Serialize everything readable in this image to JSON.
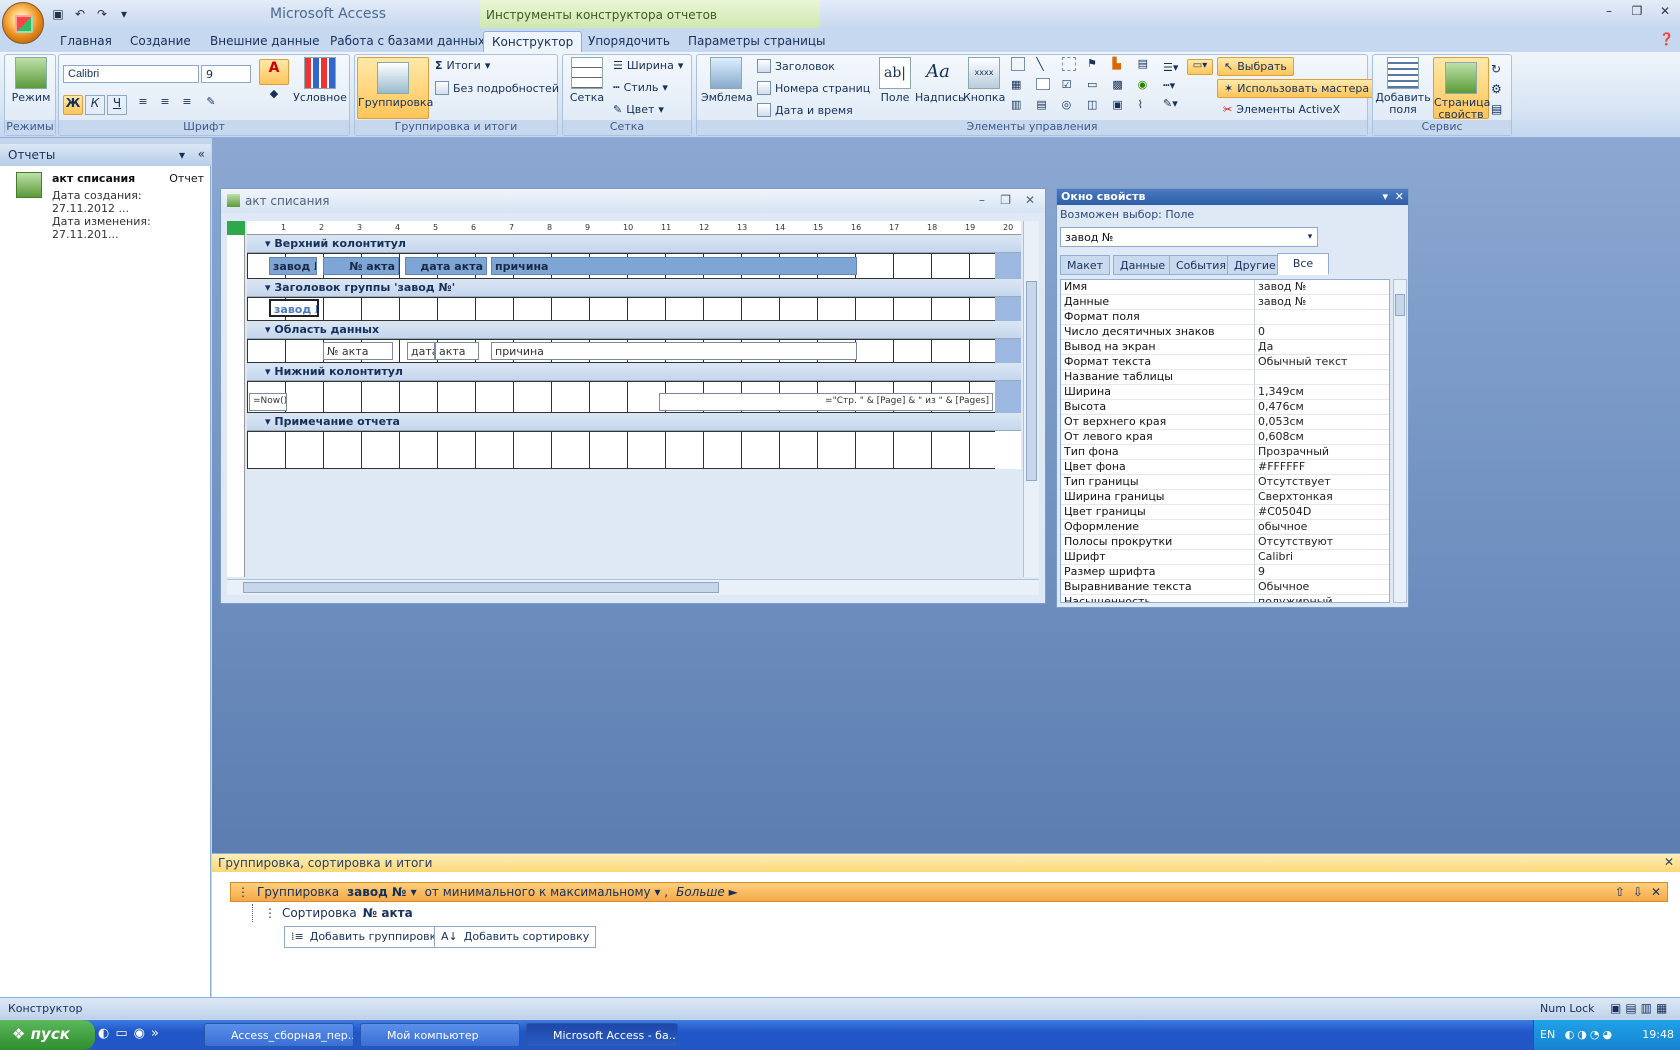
{
  "app_title": "Microsoft Access",
  "context_tab_title": "Инструменты конструктора отчетов",
  "tabs": [
    "Главная",
    "Создание",
    "Внешние данные",
    "Работа с базами данных",
    "Конструктор",
    "Упорядочить",
    "Параметры страницы"
  ],
  "ribbon": {
    "groups": [
      "Режимы",
      "Шрифт",
      "Группировка и итоги",
      "Сетка",
      "Элементы управления",
      "Сервис"
    ],
    "mode_label": "Режим",
    "font_name": "Calibri",
    "font_size": "9",
    "conditional": "Условное",
    "grouping": "Группировка",
    "totals": "Итоги",
    "hide_details": "Без подробностей",
    "grid": "Сетка",
    "width": "Ширина",
    "style": "Стиль",
    "color": "Цвет",
    "emblem": "Эмблема",
    "title": "Заголовок",
    "page_numbers": "Номера страниц",
    "date_time": "Дата и время",
    "field": "Поле",
    "label": "Надпись",
    "button": "Кнопка",
    "button_sample": "xxxx",
    "select": "Выбрать",
    "use_wizards": "Использовать мастера",
    "activex": "Элементы ActiveX",
    "add_fields": "Добавить поля",
    "property_sheet": "Страница свойств",
    "bold": "Ж",
    "italic": "К",
    "underline": "Ч"
  },
  "nav": {
    "header": "Отчеты",
    "item_name": "акт списания",
    "item_type": "Отчет",
    "created": "Дата создания: 27.11.2012 ...",
    "modified": "Дата изменения: 27.11.201..."
  },
  "report_window": {
    "title": "акт списания",
    "ruler": [
      "1",
      "2",
      "3",
      "4",
      "5",
      "6",
      "7",
      "8",
      "9",
      "10",
      "11",
      "12",
      "13",
      "14",
      "15",
      "16",
      "17",
      "18",
      "19",
      "20"
    ],
    "sections": [
      "Верхний колонтитул",
      "Заголовок группы 'завод №'",
      "Область данных",
      "Нижний колонтитул",
      "Примечание отчета"
    ],
    "header_labels": [
      "завод №",
      "№ акта",
      "дата акта",
      "причина"
    ],
    "group_field": "завод №",
    "detail_fields": [
      "№ акта",
      "дата",
      "акта",
      "причина"
    ],
    "footer_now": "=Now()",
    "footer_pages": "=\"Стр. \" & [Page] & \" из \" & [Pages]"
  },
  "property_sheet": {
    "title": "Окно свойств",
    "selection_type": "Возможен выбор:  Поле",
    "selected_object": "завод №",
    "tabs": [
      "Макет",
      "Данные",
      "События",
      "Другие",
      "Все"
    ],
    "rows": [
      [
        "Имя",
        "завод №"
      ],
      [
        "Данные",
        "завод №"
      ],
      [
        "Формат поля",
        ""
      ],
      [
        "Число десятичных знаков",
        "0"
      ],
      [
        "Вывод на экран",
        "Да"
      ],
      [
        "Формат текста",
        "Обычный текст"
      ],
      [
        "Название таблицы",
        ""
      ],
      [
        "Ширина",
        "1,349см"
      ],
      [
        "Высота",
        "0,476см"
      ],
      [
        "От верхнего края",
        "0,053см"
      ],
      [
        "От левого края",
        "0,608см"
      ],
      [
        "Тип фона",
        "Прозрачный"
      ],
      [
        "Цвет фона",
        "#FFFFFF"
      ],
      [
        "Тип границы",
        "Отсутствует"
      ],
      [
        "Ширина границы",
        "Сверхтонкая"
      ],
      [
        "Цвет границы",
        "#C0504D"
      ],
      [
        "Оформление",
        "обычное"
      ],
      [
        "Полосы прокрутки",
        "Отсутствуют"
      ],
      [
        "Шрифт",
        "Calibri"
      ],
      [
        "Размер шрифта",
        "9"
      ],
      [
        "Выравнивание текста",
        "Обычное"
      ],
      [
        "Насыщенность",
        "полужирный"
      ]
    ]
  },
  "grouping_pane": {
    "title": "Группировка, сортировка и итоги",
    "group_prefix": "Группировка",
    "group_field": "завод №",
    "group_order": "от минимального к максимальному",
    "more": "Больше ►",
    "sort_prefix": "Сортировка",
    "sort_field": "№ акта",
    "add_group": "Добавить группировку",
    "add_sort": "Добавить сортировку"
  },
  "status": {
    "left": "Конструктор",
    "numlock": "Num Lock"
  },
  "taskbar": {
    "start": "пуск",
    "items": [
      "Access_сборная_пер...",
      "Мой компьютер",
      "Microsoft Access - ба..."
    ],
    "lang": "EN",
    "time": "19:48"
  },
  "colors": {
    "accent": "#f5a94a",
    "label_fill": "#7fa4d6",
    "workspace": "#6e8fbf"
  }
}
